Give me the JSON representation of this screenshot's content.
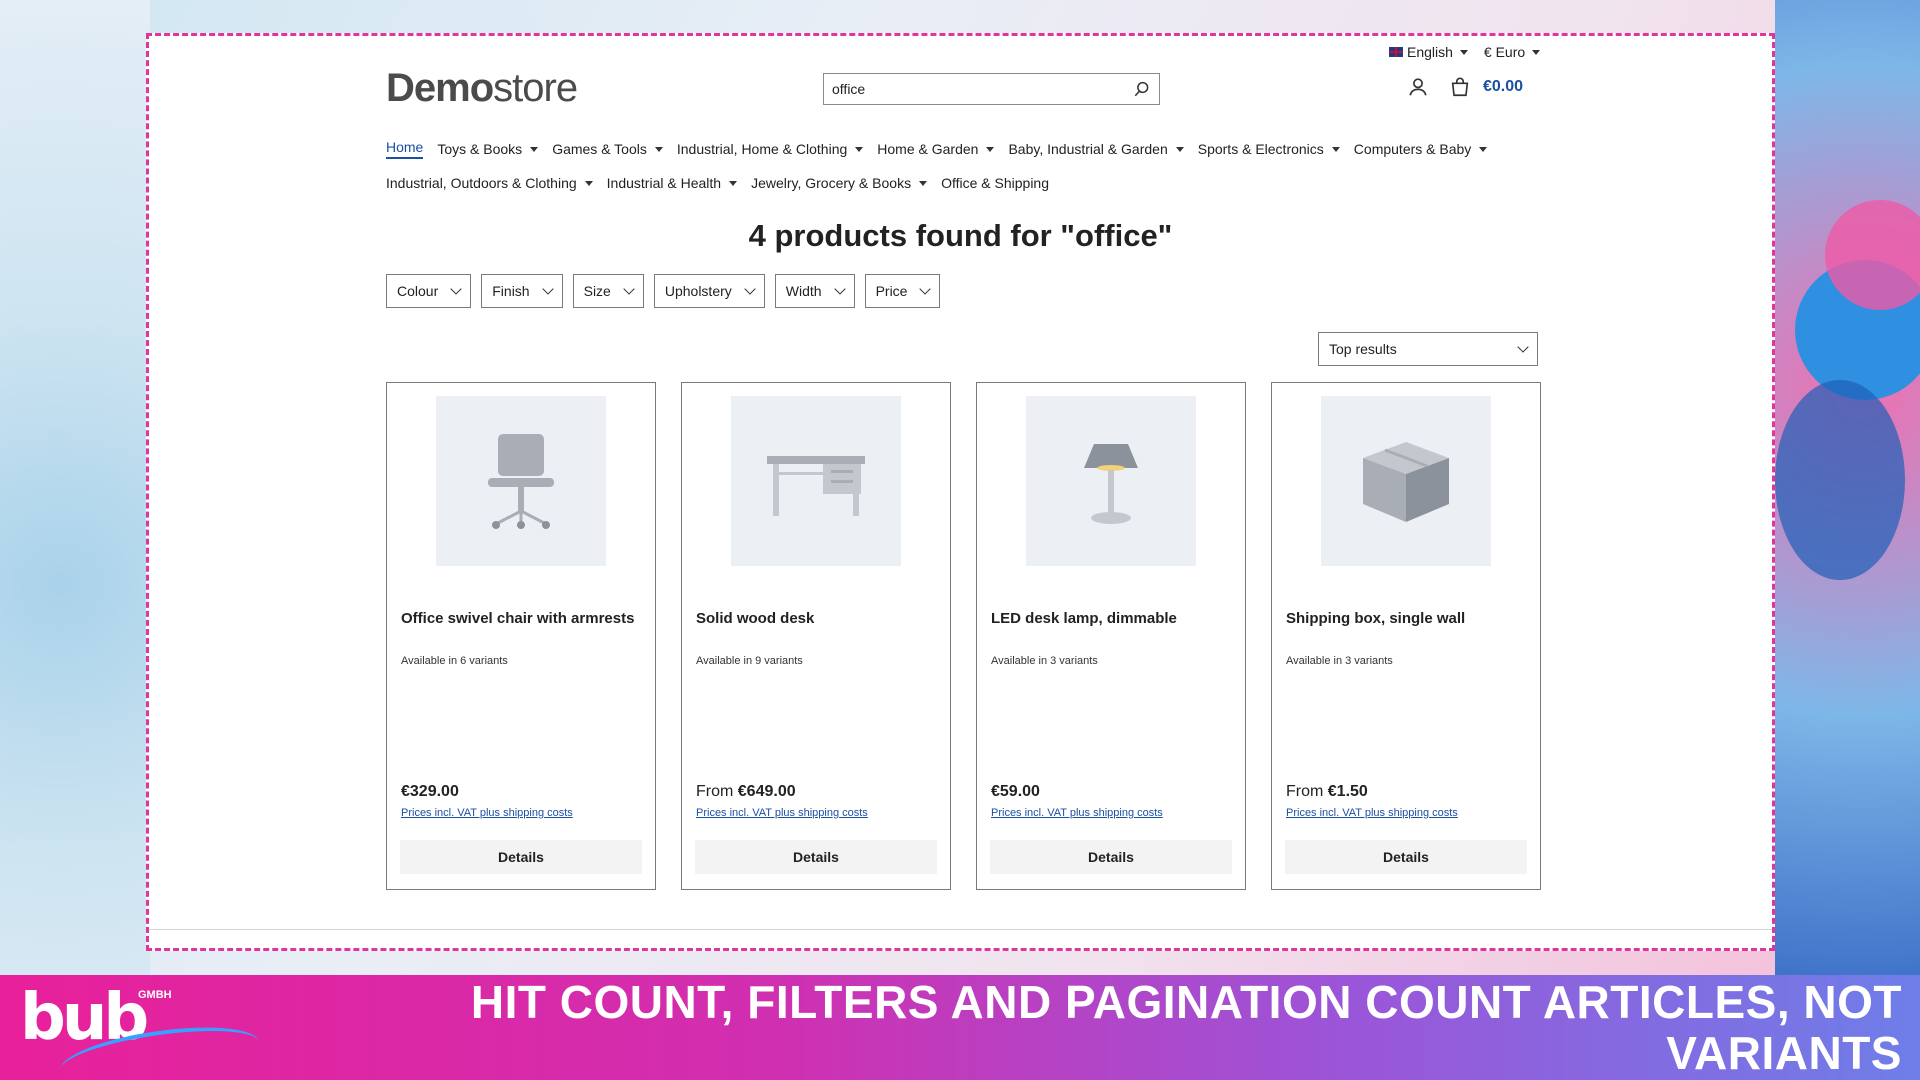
{
  "topbar": {
    "language": "English",
    "currency": "€ Euro"
  },
  "logo": {
    "bold": "Demo",
    "light": "store"
  },
  "search": {
    "value": "office"
  },
  "cart": {
    "total": "€0.00"
  },
  "nav": {
    "row1": [
      {
        "label": "Home",
        "active": true,
        "dropdown": false
      },
      {
        "label": "Toys & Books",
        "dropdown": true
      },
      {
        "label": "Games & Tools",
        "dropdown": true
      },
      {
        "label": "Industrial, Home & Clothing",
        "dropdown": true
      },
      {
        "label": "Home & Garden",
        "dropdown": true
      },
      {
        "label": "Baby, Industrial & Garden",
        "dropdown": true
      },
      {
        "label": "Sports & Electronics",
        "dropdown": true
      },
      {
        "label": "Computers & Baby",
        "dropdown": true
      }
    ],
    "row2": [
      {
        "label": "Industrial, Outdoors & Clothing",
        "dropdown": true
      },
      {
        "label": "Industrial & Health",
        "dropdown": true
      },
      {
        "label": "Jewelry, Grocery & Books",
        "dropdown": true
      },
      {
        "label": "Office & Shipping",
        "dropdown": false
      }
    ]
  },
  "results": {
    "heading": "4 products found for \"office\""
  },
  "filters": [
    "Colour",
    "Finish",
    "Size",
    "Upholstery",
    "Width",
    "Price"
  ],
  "sort": {
    "selected": "Top results"
  },
  "products": [
    {
      "name": "Office swivel chair with armrests",
      "variants": "Available in 6 variants",
      "price_prefix": "",
      "price": "€329.00",
      "vat": "Prices incl. VAT plus shipping costs",
      "button": "Details",
      "icon": "chair-icon"
    },
    {
      "name": "Solid wood desk",
      "variants": "Available in 9 variants",
      "price_prefix": "From ",
      "price": "€649.00",
      "vat": "Prices incl. VAT plus shipping costs",
      "button": "Details",
      "icon": "desk-icon"
    },
    {
      "name": "LED desk lamp, dimmable",
      "variants": "Available in 3 variants",
      "price_prefix": "",
      "price": "€59.00",
      "vat": "Prices incl. VAT plus shipping costs",
      "button": "Details",
      "icon": "lamp-icon"
    },
    {
      "name": "Shipping box, single wall",
      "variants": "Available in 3 variants",
      "price_prefix": "From ",
      "price": "€1.50",
      "vat": "Prices incl. VAT plus shipping costs",
      "button": "Details",
      "icon": "box-icon"
    }
  ],
  "banner": {
    "brand": "bub",
    "brand_suffix": "GMBH",
    "headline": "HIT COUNT, FILTERS AND PAGINATION COUNT ARTICLES, NOT VARIANTS"
  },
  "colors": {
    "accent": "#1a4fa3",
    "frame": "#e0359a",
    "banner_start": "#e8209a",
    "banner_end": "#6e7ee8"
  }
}
